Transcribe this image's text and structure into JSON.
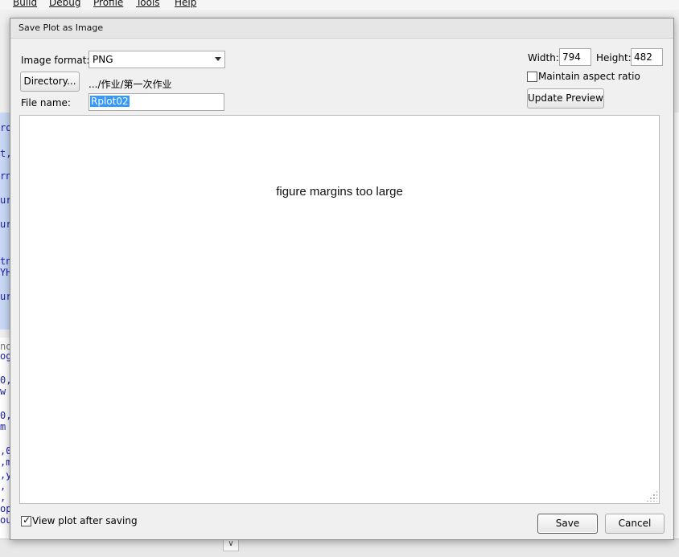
{
  "background": {
    "menu": [
      "Build",
      "Debug",
      "Profile",
      "Tools",
      "Help"
    ],
    "code_lines": [
      "ro",
      "t,",
      "rn",
      "ur",
      "ur",
      "tn",
      "YH",
      "ur",
      "no",
      "og",
      "0,",
      " w",
      "0,",
      " m",
      ",0",
      ",m",
      ",y",
      ",",
      ",",
      "op",
      "ou"
    ]
  },
  "dialog": {
    "title": "Save Plot as Image",
    "image_format_label": "Image format:",
    "image_format_value": "PNG",
    "directory_button": "Directory...",
    "directory_path": ".../作业/第一次作业",
    "file_name_label": "File name:",
    "file_name_value": "Rplot02",
    "width_label": "Width:",
    "width_value": "794",
    "height_label": "Height:",
    "height_value": "482",
    "maintain_aspect_label": "Maintain aspect ratio",
    "maintain_aspect_checked": false,
    "update_preview_button": "Update Preview",
    "preview_message": "figure margins too large",
    "view_after_saving_label": "View plot after saving",
    "view_after_saving_checked": true,
    "save_button": "Save",
    "cancel_button": "Cancel"
  }
}
